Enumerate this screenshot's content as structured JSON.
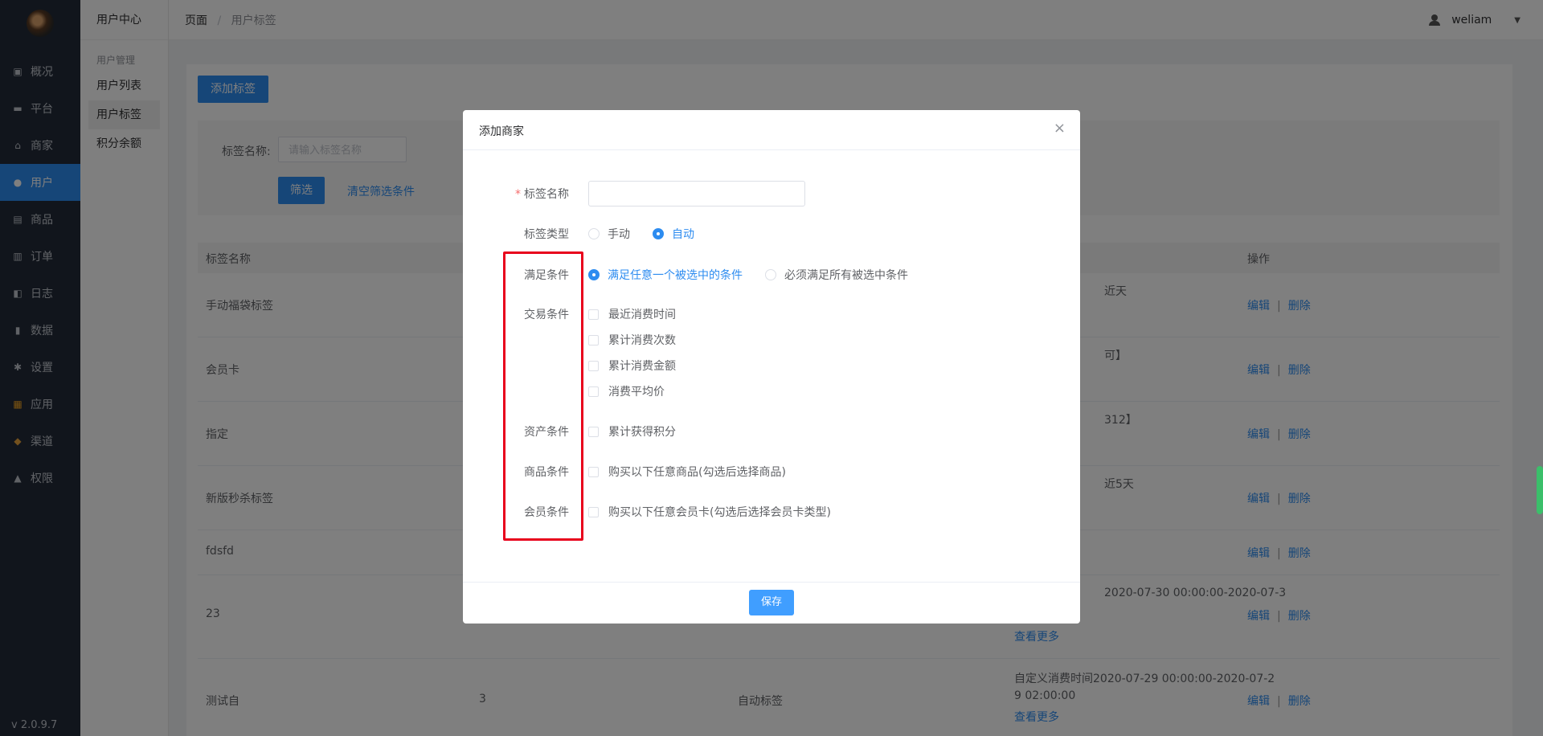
{
  "sidebar": {
    "items": [
      {
        "label": "概况",
        "icon": "dashboard-icon"
      },
      {
        "label": "平台",
        "icon": "monitor-icon"
      },
      {
        "label": "商家",
        "icon": "store-icon"
      },
      {
        "label": "用户",
        "icon": "user-icon"
      },
      {
        "label": "商品",
        "icon": "bag-icon"
      },
      {
        "label": "订单",
        "icon": "order-icon"
      },
      {
        "label": "日志",
        "icon": "book-icon"
      },
      {
        "label": "数据",
        "icon": "chart-icon"
      },
      {
        "label": "设置",
        "icon": "gear-icon"
      },
      {
        "label": "应用",
        "icon": "apps-icon"
      },
      {
        "label": "渠道",
        "icon": "cube-icon"
      },
      {
        "label": "权限",
        "icon": "lock-icon"
      }
    ],
    "version": "v 2.0.9.7",
    "active_color": "#2d8cf0"
  },
  "subnav": {
    "title": "用户中心",
    "group": "用户管理",
    "items": [
      "用户列表",
      "用户标签",
      "积分余额"
    ]
  },
  "header": {
    "crumb_root": "页面",
    "crumb_sep": "/",
    "crumb_current": "用户标签",
    "username": "weliam"
  },
  "page": {
    "add_button": "添加标签",
    "filter_label": "标签名称:",
    "filter_placeholder": "请输入标签名称",
    "filter_button": "筛选",
    "clear_button": "清空筛选条件"
  },
  "table": {
    "col_name": "标签名称",
    "col_op": "操作",
    "edit": "编辑",
    "delete": "删除",
    "sep": "|",
    "more": "查看更多",
    "rows": [
      {
        "name": "手动福袋标签",
        "partial": "近天",
        "more": ""
      },
      {
        "name": "会员卡",
        "partial": "可】",
        "more": ""
      },
      {
        "name": "指定",
        "partial": "312】",
        "more": ""
      },
      {
        "name": "新版秒杀标签",
        "partial": "近5天",
        "more": ""
      },
      {
        "name": "fdsfd",
        "partial": "",
        "more": ""
      },
      {
        "name": "23",
        "partial": "2020-07-30 00:00:00-2020-07-3",
        "more": "查看更多"
      },
      {
        "name": "测试自",
        "count": "3",
        "type": "自动标签",
        "partial_line1": "自定义消费时间2020-07-29 00:00:00-2020-07-2",
        "partial_line2": "9 02:00:00",
        "more": "查看更多"
      }
    ]
  },
  "modal": {
    "title": "添加商家",
    "close": "×",
    "name_label": "标签名称",
    "type_label": "标签类型",
    "type_manual": "手动",
    "type_auto": "自动",
    "meet_label": "满足条件",
    "meet_any": "满足任意一个被选中的条件",
    "meet_all": "必须满足所有被选中条件",
    "trade_label": "交易条件",
    "trade_options": [
      "最近消费时间",
      "累计消费次数",
      "累计消费金额",
      "消费平均价"
    ],
    "asset_label": "资产条件",
    "asset_options": [
      "累计获得积分"
    ],
    "goods_label": "商品条件",
    "goods_options": [
      "购买以下任意商品(勾选后选择商品)"
    ],
    "member_label": "会员条件",
    "member_options": [
      "购买以下任意会员卡(勾选后选择会员卡类型)"
    ],
    "save": "保存",
    "highlight_color": "#e8001c"
  }
}
